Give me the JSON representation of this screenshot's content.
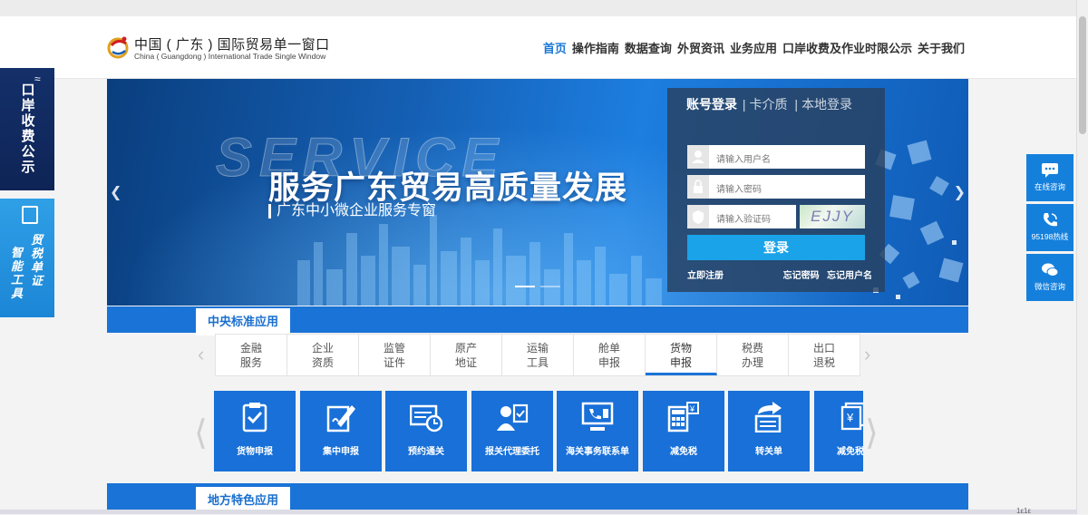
{
  "header": {
    "logo_cn": "中国 ( 广东 ) 国际贸易单一窗口",
    "logo_en": "China ( Guangdong ) International Trade Single Window",
    "nav": [
      "首页",
      "操作指南",
      "数据查询",
      "外贸资讯",
      "业务应用",
      "口岸收费及作业时限公示",
      "关于我们"
    ]
  },
  "banner": {
    "bg_word": "SERVICE",
    "headline": "服务广东贸易高质量发展",
    "subline": "广东中小微企业服务专窗"
  },
  "login": {
    "tab_active": "账号登录",
    "tab_2": "卡介质",
    "tab_3": "本地登录",
    "username_placeholder": "请输入用户名",
    "password_placeholder": "请输入密码",
    "code_placeholder": "请输入验证码",
    "captcha": "EJJY",
    "submit": "登录",
    "register": "立即注册",
    "forgot_password": "忘记密码",
    "forgot_username": "忘记用户名"
  },
  "left_float": {
    "notice": "口岸收费公示",
    "tool_col1": "贸税单证",
    "tool_col2": "智能工具"
  },
  "right_float": [
    {
      "label": "在线咨询",
      "icon": "chat-icon"
    },
    {
      "label": "95198热线",
      "icon": "phone-icon"
    },
    {
      "label": "微信咨询",
      "icon": "wechat-icon"
    }
  ],
  "central": {
    "title": "中央标准应用",
    "categories": [
      {
        "l1": "金融",
        "l2": "服务"
      },
      {
        "l1": "企业",
        "l2": "资质"
      },
      {
        "l1": "监管",
        "l2": "证件"
      },
      {
        "l1": "原产",
        "l2": "地证"
      },
      {
        "l1": "运输",
        "l2": "工具"
      },
      {
        "l1": "舱单",
        "l2": "申报"
      },
      {
        "l1": "货物",
        "l2": "申报"
      },
      {
        "l1": "税费",
        "l2": "办理"
      },
      {
        "l1": "出口",
        "l2": "退税"
      }
    ],
    "active_category": 6,
    "tiles": [
      "货物申报",
      "集中申报",
      "预约通关",
      "报关代理委托",
      "海关事务联系单",
      "减免税",
      "转关单",
      "减免税后"
    ]
  },
  "local": {
    "title": "地方特色应用"
  },
  "footer_fragment": "1ε1ε"
}
